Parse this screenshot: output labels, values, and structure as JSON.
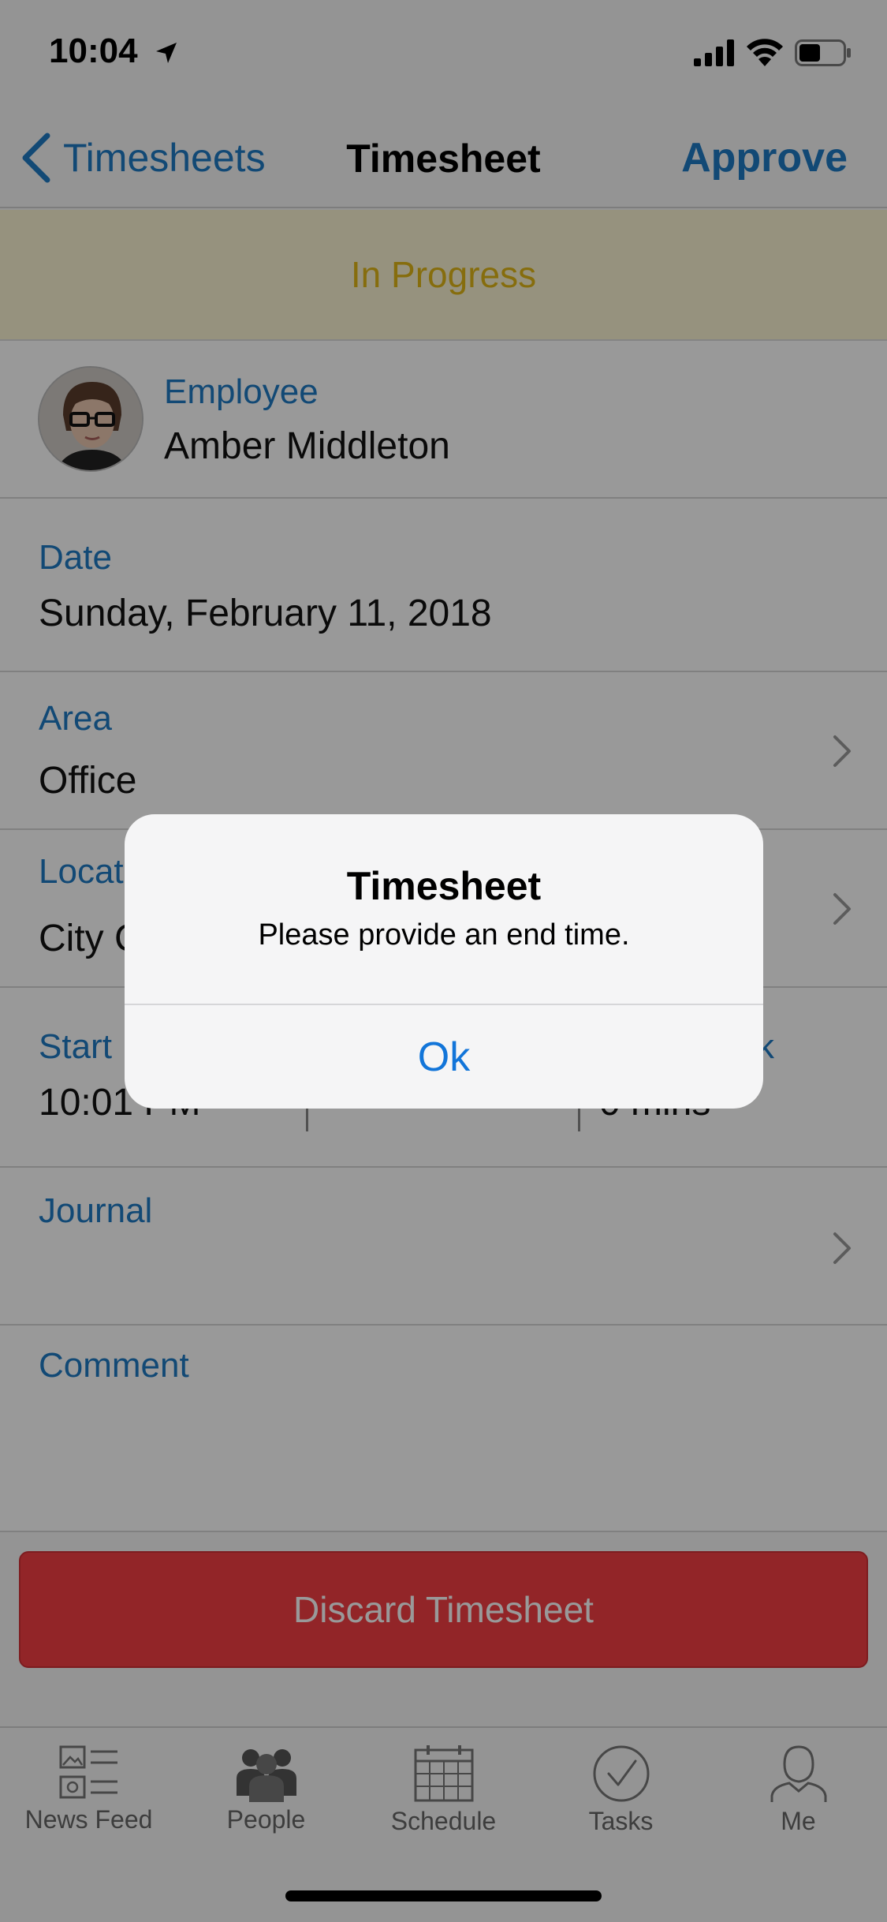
{
  "status_bar": {
    "time": "10:04"
  },
  "nav": {
    "back_label": "Timesheets",
    "title": "Timesheet",
    "approve_label": "Approve"
  },
  "status_banner": {
    "text": "In Progress"
  },
  "employee": {
    "label": "Employee",
    "name": "Amber Middleton"
  },
  "date": {
    "label": "Date",
    "value": "Sunday, February 11, 2018"
  },
  "area": {
    "label": "Area",
    "value": "Office"
  },
  "location": {
    "label": "Locat",
    "value": "City C"
  },
  "times": {
    "start_label": "Start",
    "start_value": "10:01 PM",
    "break_label": "k",
    "break_value": "0 mins"
  },
  "journal": {
    "label": "Journal"
  },
  "comment": {
    "label": "Comment"
  },
  "discard": {
    "label": "Discard Timesheet"
  },
  "tabs": [
    {
      "label": "News Feed",
      "icon": "news-feed-icon"
    },
    {
      "label": "People",
      "icon": "people-icon"
    },
    {
      "label": "Schedule",
      "icon": "calendar-icon"
    },
    {
      "label": "Tasks",
      "icon": "checkmark-circle-icon"
    },
    {
      "label": "Me",
      "icon": "person-icon"
    }
  ],
  "alert": {
    "title": "Timesheet",
    "message": "Please provide an end time.",
    "ok_label": "Ok"
  },
  "colors": {
    "accent": "#1f7ac4",
    "banner_bg": "#fbf4d2",
    "banner_text": "#e0b617",
    "discard_bg": "#f33f44",
    "alert_button": "#1275d9"
  }
}
